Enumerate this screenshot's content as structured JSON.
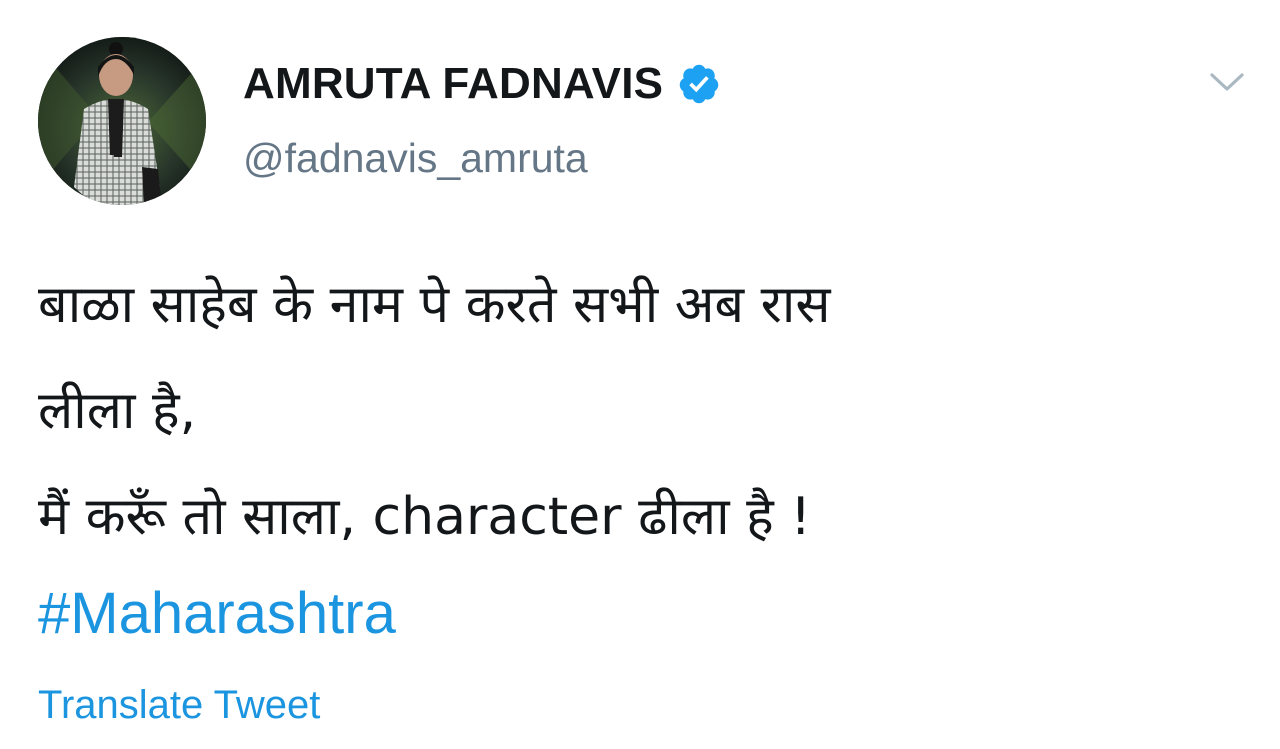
{
  "tweet": {
    "author": {
      "display_name": "AMRUTA FADNAVIS",
      "handle": "@fadnavis_amruta",
      "verified_icon": "verified-badge-icon",
      "avatar_icon": "profile-photo"
    },
    "menu_icon": "chevron-down-icon",
    "text_lines": [
      "बाळा साहेब के नाम पे करते सभी अब रास",
      "लीला है,",
      "मैं करूँ तो साला, character ढीला है !"
    ],
    "hashtag": "#Maharashtra",
    "translate_label": "Translate Tweet"
  },
  "colors": {
    "text": "#14171a",
    "secondary_text": "#657786",
    "link": "#1b95e0",
    "verified_badge": "#1da1f2",
    "caret": "#aab8c2"
  }
}
